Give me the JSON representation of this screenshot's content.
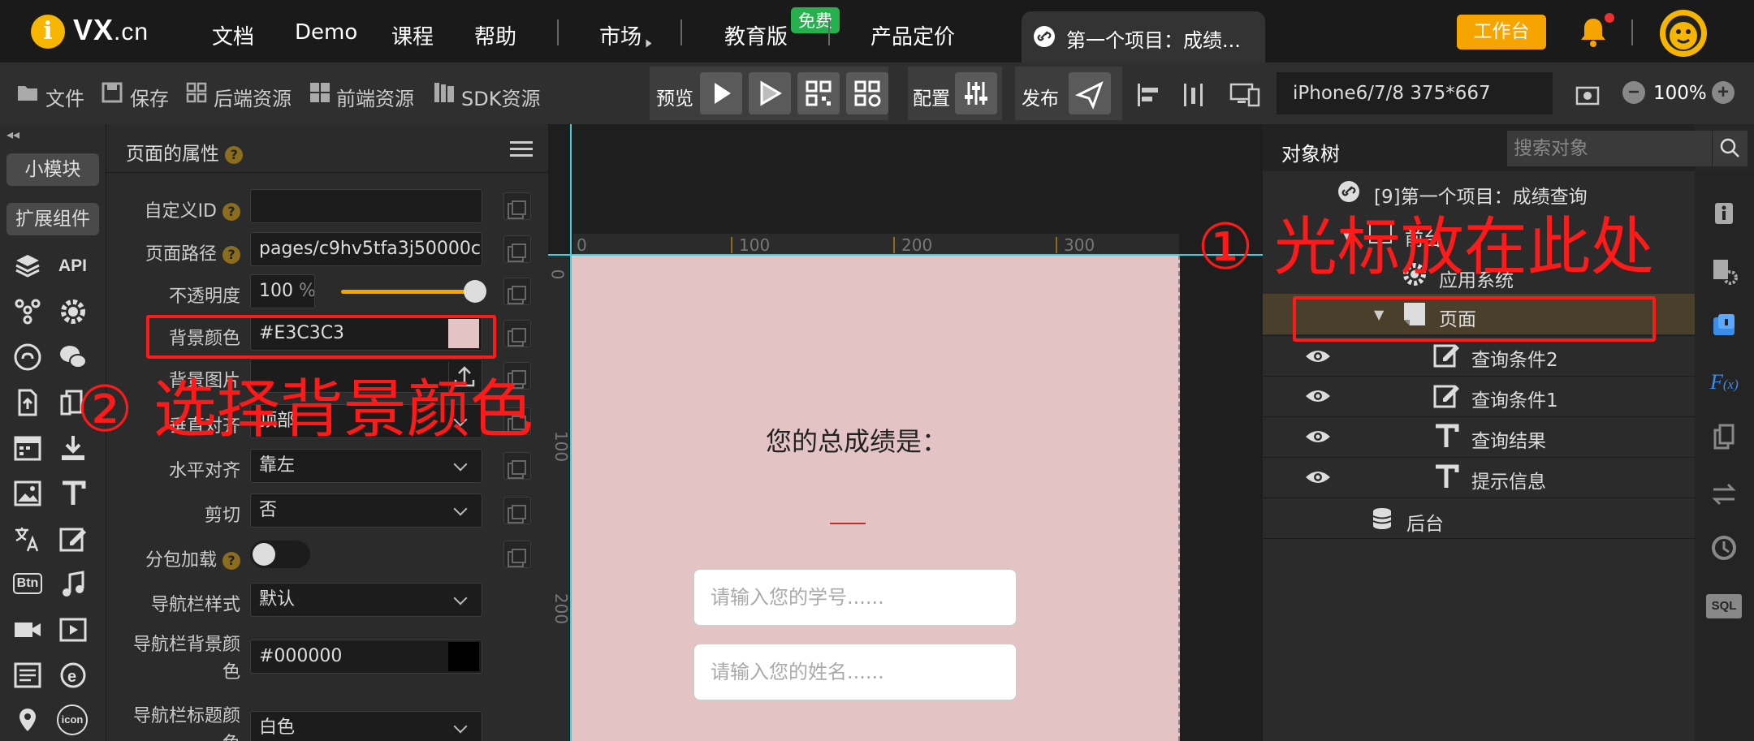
{
  "topnav": {
    "logo_letter": "i",
    "logo_brand": "VX",
    "logo_suffix": ".cn",
    "items": [
      "文档",
      "Demo",
      "课程",
      "帮助",
      "市场",
      "教育版",
      "产品定价"
    ],
    "free_badge": "免费",
    "project_tab": "第一个项目：成绩...",
    "workbench": "工作台"
  },
  "toolbar": {
    "file": "文件",
    "save": "保存",
    "backend_res": "后端资源",
    "frontend_res": "前端资源",
    "sdk_res": "SDK资源",
    "preview": "预览",
    "config": "配置",
    "publish": "发布",
    "device": "iPhone6/7/8 375*667",
    "zoom": "100%",
    "zoom_minus": "−",
    "zoom_plus": "+"
  },
  "leftbar": {
    "small_module": "小模块",
    "ext_components": "扩展组件",
    "api": "API",
    "btn": "Btn",
    "icon": "icon"
  },
  "props": {
    "title": "页面的属性",
    "help": "?",
    "fields": {
      "custom_id": {
        "label": "自定义ID",
        "value": ""
      },
      "page_path": {
        "label": "页面路径",
        "value": "pages/c9hv5tfa3j50000c"
      },
      "opacity": {
        "label": "不透明度",
        "value": "100",
        "unit": "%",
        "level": 1.0
      },
      "bg_color": {
        "label": "背景颜色",
        "value": "#E3C3C3"
      },
      "bg_image": {
        "label": "背景图片",
        "value": ""
      },
      "v_align": {
        "label": "垂直对齐",
        "value": "顶部"
      },
      "h_align": {
        "label": "水平对齐",
        "value": "靠左"
      },
      "clip": {
        "label": "剪切",
        "value": "否"
      },
      "subpackage": {
        "label": "分包加载",
        "on": false
      },
      "nav_style": {
        "label": "导航栏样式",
        "value": "默认"
      },
      "nav_bg": {
        "label_1": "导航栏背景颜",
        "label_2": "色",
        "value": "#000000"
      },
      "nav_title": {
        "label_1": "导航栏标题颜",
        "label_2": "色",
        "value": "白色"
      }
    }
  },
  "canvas": {
    "ruler_top": [
      "0",
      "100",
      "200",
      "300"
    ],
    "ruler_left": [
      "0",
      "100",
      "200"
    ],
    "page_bg": "#E3C3C3",
    "result_label": "您的总成绩是：",
    "inputs": [
      "请输入您的学号......",
      "请输入您的姓名......"
    ]
  },
  "tree": {
    "title": "对象树",
    "search_placeholder": "搜索对象",
    "root": "[9]第一个项目：成绩查询",
    "frontend": "前台",
    "app_system": "应用系统",
    "page": "页面",
    "children": [
      "查询条件2",
      "查询条件1",
      "查询结果",
      "提示信息"
    ],
    "backend": "后台"
  },
  "annotations": {
    "step1": "① 光标放在此处",
    "step2": "② 选择背景颜色"
  },
  "colors": {
    "accent": "#f5a400",
    "annotation": "#ff1a1a",
    "selected_row": "#4a3f2a"
  }
}
